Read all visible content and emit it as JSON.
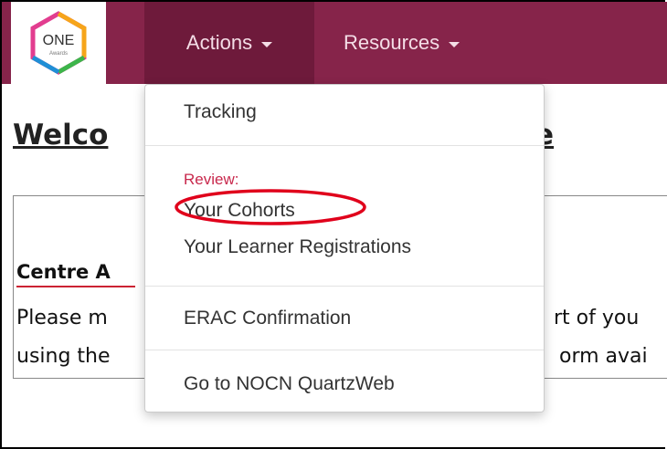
{
  "navbar": {
    "logo_text": "ONE",
    "logo_subtext": "Awards",
    "actions_label": "Actions",
    "resources_label": "Resources",
    "bg_color": "#86244a",
    "active_color": "#6e1a3b"
  },
  "page": {
    "welcome_visible_start": "Welco",
    "welcome_visible_end": "e",
    "centre_heading_visible": "Centre A",
    "line1_left": "Please m",
    "line1_right": "rt of you",
    "line2_left": "using the",
    "line2_right": "orm avai"
  },
  "dropdown": {
    "tracking": "Tracking",
    "review_header": "Review:",
    "your_cohorts": "Your Cohorts",
    "learner_registrations": "Your Learner Registrations",
    "erac_confirmation": "ERAC Confirmation",
    "go_to_quartzweb": "Go to NOCN QuartzWeb",
    "header_color": "#c8284c",
    "highlight_color": "#e0001b"
  }
}
